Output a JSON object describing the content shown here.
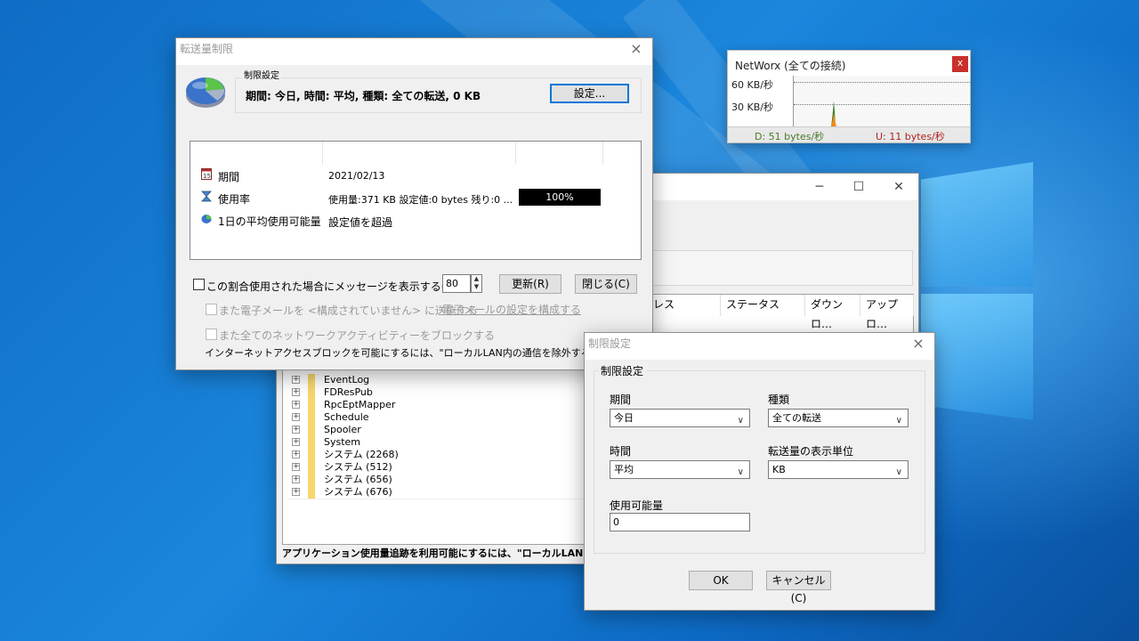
{
  "background_app": {
    "columns": [
      "レス",
      "ステータス",
      "ダウンロ…",
      "アップロ…"
    ],
    "tree_items": [
      "EventLog",
      "FDResPub",
      "RpcEptMapper",
      "Schedule",
      "Spooler",
      "System",
      "システム (2268)",
      "システム (512)",
      "システム (656)",
      "システム (676)"
    ],
    "status_text": "アプリケーション使用量追跡を利用可能にするには、\"ローカルLAN"
  },
  "networx": {
    "title": "NetWorx (全ての接続)",
    "close_label": "x",
    "scale_high": "60 KB/秒",
    "scale_low": "30 KB/秒",
    "download": "D: 51 bytes/秒",
    "upload": "U: 11 bytes/秒",
    "download_color": "#4a7a2a",
    "upload_color": "#b02020"
  },
  "main_dialog": {
    "title": "転送量制限",
    "close_label": "×",
    "group_label": "制限設定",
    "summary": "期間: 今日, 時間: 平均, 種類: 全ての転送, 0 KB",
    "settings_button": "設定...",
    "rows": [
      {
        "label": "期間",
        "value": "2021/02/13"
      },
      {
        "label": "使用率",
        "value": "使用量:371 KB 設定値:0 bytes 残り:0 ..."
      },
      {
        "label": "1日の平均使用可能量",
        "value": "設定値を超過"
      }
    ],
    "usage_percent": "100%",
    "usage_fraction": 1.0,
    "notify_label": "この割合使用された場合にメッセージを表示する(%)",
    "notify_value": "80",
    "refresh_button": "更新(R)",
    "close_button": "閉じる(C)",
    "email_label": "また電子メールを <構成されていません> に送信する",
    "email_link": "電子メールの設定を構成する",
    "block_label": "また全てのネットワークアクティビティーをブロックする",
    "footer_note": "インターネットアクセスブロックを可能にするには、\"ローカルLAN内の通信を除外する\"オプションを"
  },
  "limit_dialog": {
    "title": "制限設定",
    "close_label": "×",
    "group_label": "制限設定",
    "period_label": "期間",
    "period_value": "今日",
    "type_label": "種類",
    "type_value": "全ての転送",
    "time_label": "時間",
    "time_value": "平均",
    "unit_label": "転送量の表示単位",
    "unit_value": "KB",
    "allowance_label": "使用可能量",
    "allowance_value": "0",
    "ok_button": "OK",
    "cancel_button": "キャンセル(C)"
  }
}
